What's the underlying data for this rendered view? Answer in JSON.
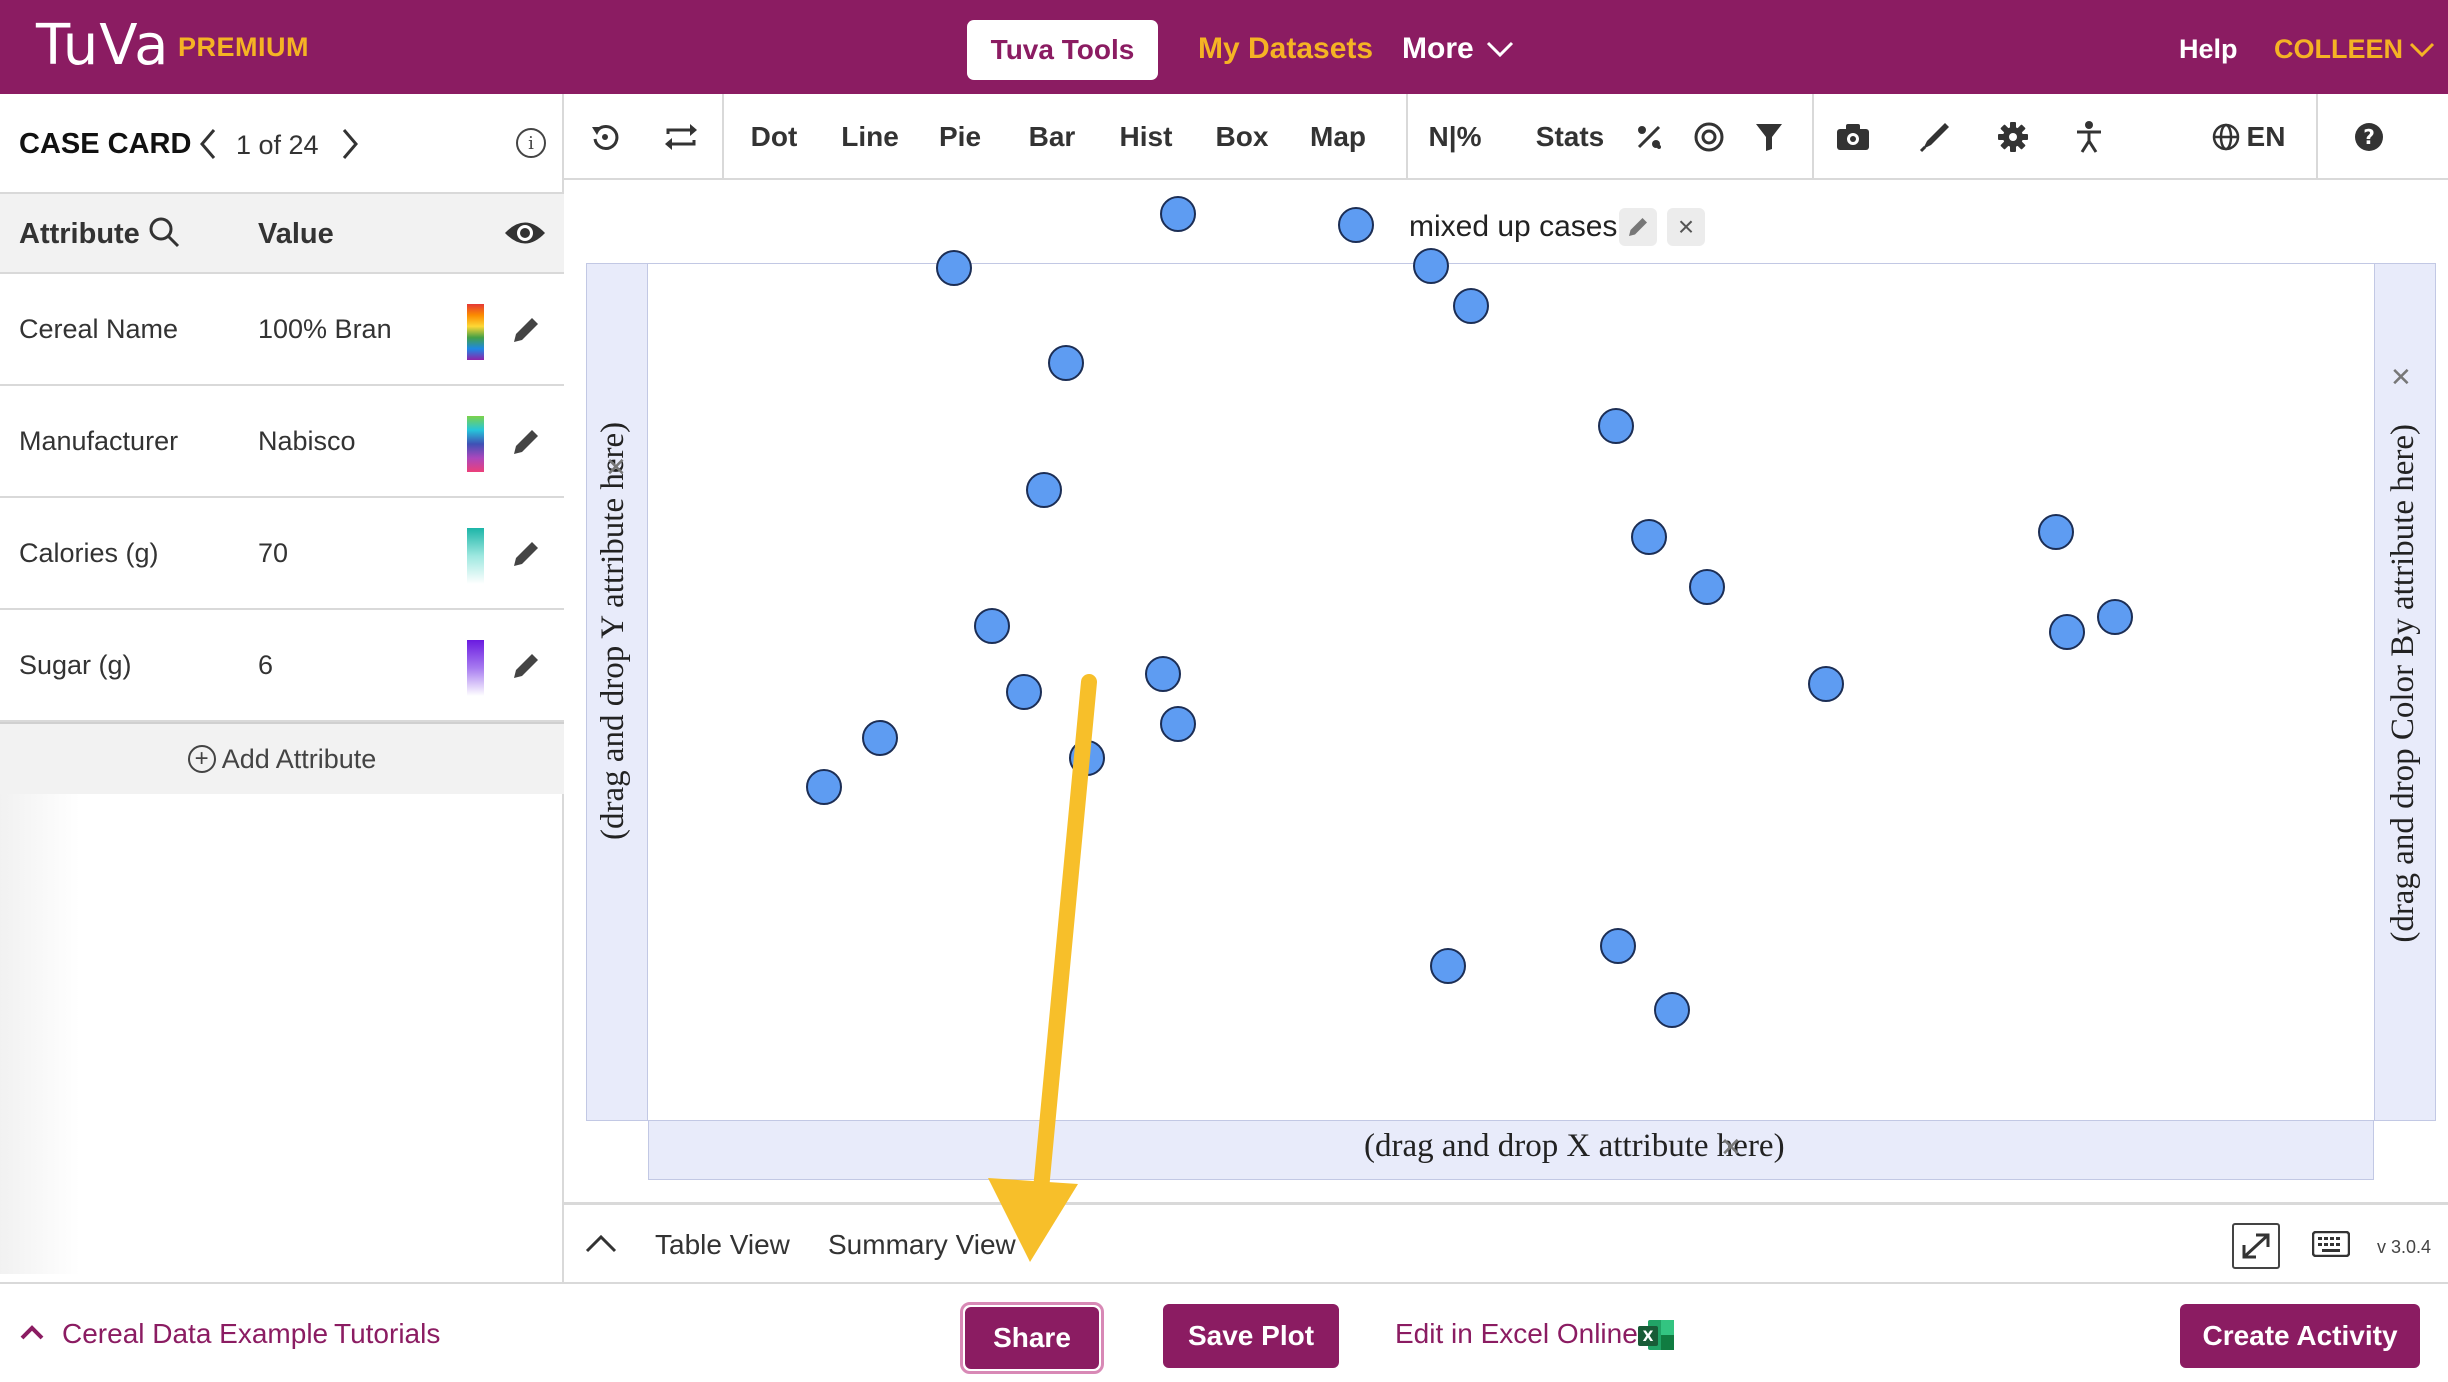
{
  "header": {
    "logo": "TuVa",
    "tier": "PREMIUM",
    "tools_button": "Tuva Tools",
    "datasets": "My Datasets",
    "more": "More",
    "help": "Help",
    "user": "COLLEEN"
  },
  "case_card": {
    "title": "CASE CARD",
    "position": "1 of 24",
    "attribute_header": "Attribute",
    "value_header": "Value",
    "rows": [
      {
        "name": "Cereal Name",
        "value": "100% Bran"
      },
      {
        "name": "Manufacturer",
        "value": "Nabisco"
      },
      {
        "name": "Calories (g)",
        "value": "70"
      },
      {
        "name": "Sugar (g)",
        "value": "6"
      }
    ],
    "add_attribute": "Add Attribute"
  },
  "toolbar": {
    "dot": "Dot",
    "line": "Line",
    "pie": "Pie",
    "bar": "Bar",
    "hist": "Hist",
    "box": "Box",
    "map": "Map",
    "n_percent": "N|%",
    "stats": "Stats",
    "language": "EN"
  },
  "plot": {
    "title": "mixed up cases",
    "y_drop": "(drag and drop Y attribute here)",
    "x_drop": "(drag and drop X attribute here)",
    "color_drop": "(drag and drop Color By attribute here)",
    "point_count": 24,
    "point_color": "#5e9cf2"
  },
  "viewbar": {
    "table_view": "Table View",
    "summary_view": "Summary View",
    "version": "v 3.0.4"
  },
  "footer": {
    "dataset_link": "Cereal Data Example",
    "tutorials": "Tutorials",
    "share": "Share",
    "save_plot": "Save Plot",
    "edit_excel": "Edit in Excel Online",
    "create_activity": "Create Activity"
  },
  "colors": {
    "brand": "#8b1c62",
    "accent": "#f5b324",
    "annotation_arrow": "#f7bf2a"
  }
}
